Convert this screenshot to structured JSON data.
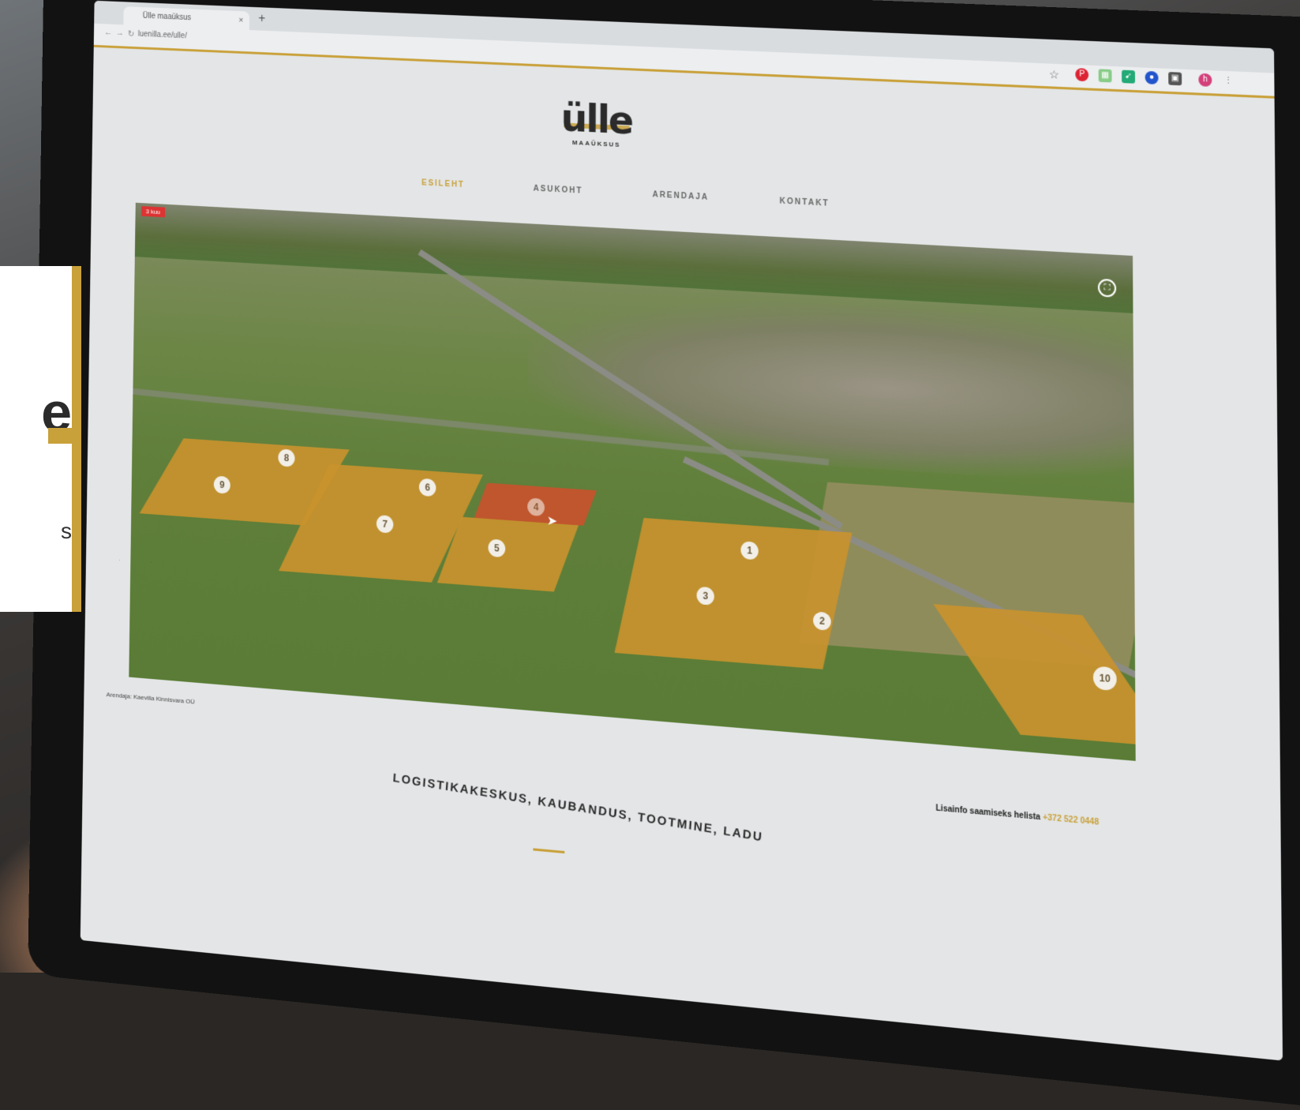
{
  "browser": {
    "tab_title": "Ülle maaüksus",
    "tab_close": "×",
    "new_tab": "+",
    "address": "luenilla.ee/ulle/"
  },
  "site": {
    "logo_word": "ülle",
    "logo_sub": "MAAÜKSUS",
    "menu": [
      "ESILEHT",
      "ASUKOHT",
      "ARENDAJA",
      "KONTAKT"
    ],
    "active_menu": "ESILEHT",
    "hero_badge": "3 kuu",
    "plots": [
      "1",
      "2",
      "3",
      "4",
      "5",
      "6",
      "7",
      "8",
      "9",
      "10"
    ],
    "credit": "Arendaja: Kaevilla Kinnisvara OÜ",
    "info_text": "Lisainfo saamiseks helista",
    "info_phone": "+372 522 0448",
    "tagline": "LOGISTIKAKESKUS, KAUBANDUS, TOOTMINE, LADU"
  },
  "colors": {
    "accent": "#c9a13a",
    "plot": "#c9932e",
    "plot_selected": "#c9532c"
  }
}
